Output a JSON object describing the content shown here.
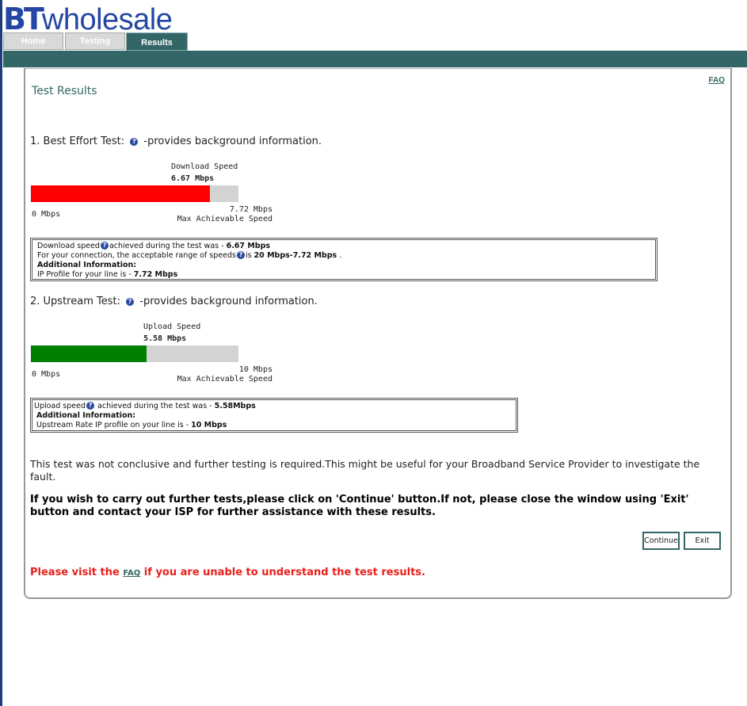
{
  "brand": {
    "logo_bt": "BT",
    "logo_wholesale": "wholesale",
    "logo_color": "#2447a4"
  },
  "tabs": [
    {
      "label": "Home",
      "active": false
    },
    {
      "label": "Testing",
      "active": false
    },
    {
      "label": "Results",
      "active": true
    }
  ],
  "accent_color": "#336666",
  "page": {
    "title": "Test Results",
    "faq_label": "FAQ"
  },
  "download": {
    "heading_prefix": "1. Best Effort Test:",
    "heading_suffix": "-provides background information.",
    "label": "Download Speed",
    "value": "6.67 Mbps",
    "min_label": "0 Mbps",
    "max_value": "7.72 Mbps",
    "max_label": "Max Achievable Speed",
    "fraction": 0.864,
    "fill_color": "#ff0000",
    "info": {
      "line1_prefix": "Download speed",
      "line1_mid": "achieved during the test was - ",
      "line1_value": "6.67 Mbps",
      "line2_prefix": "For your connection, the acceptable range of speeds",
      "line2_mid": "is ",
      "line2_value": "20 Mbps-7.72 Mbps",
      "line2_end": " .",
      "line3": "Additional Information:",
      "line4_prefix": "IP Profile for your line is - ",
      "line4_value": "7.72 Mbps"
    }
  },
  "upload": {
    "heading_prefix": "2. Upstream Test:",
    "heading_suffix": "-provides background information.",
    "label": "Upload Speed",
    "value": "5.58 Mbps",
    "min_label": "0 Mbps",
    "max_value": "10 Mbps",
    "max_label": "Max Achievable Speed",
    "fraction": 0.558,
    "fill_color": "#008000",
    "info": {
      "line1_prefix": "Upload speed",
      "line1_mid": " achieved during the test was - ",
      "line1_value": "5.58Mbps",
      "line2": "Additional Information:",
      "line3_prefix": "Upstream Rate IP profile on your line is - ",
      "line3_value": "10 Mbps"
    }
  },
  "message": {
    "inconclusive": "This test was not conclusive and further testing is required.This might be useful for your Broadband Service Provider to investigate the fault.",
    "instruction": "If you wish to carry out further tests,please click on 'Continue' button.If not, please close the window using 'Exit' button and contact your ISP for further assistance with these results."
  },
  "buttons": {
    "continue": "Continue",
    "exit": "Exit"
  },
  "footer": {
    "prefix": "Please visit the ",
    "link": "FAQ",
    "suffix": " if you are unable to understand the test results.",
    "color": "#e8201c"
  }
}
